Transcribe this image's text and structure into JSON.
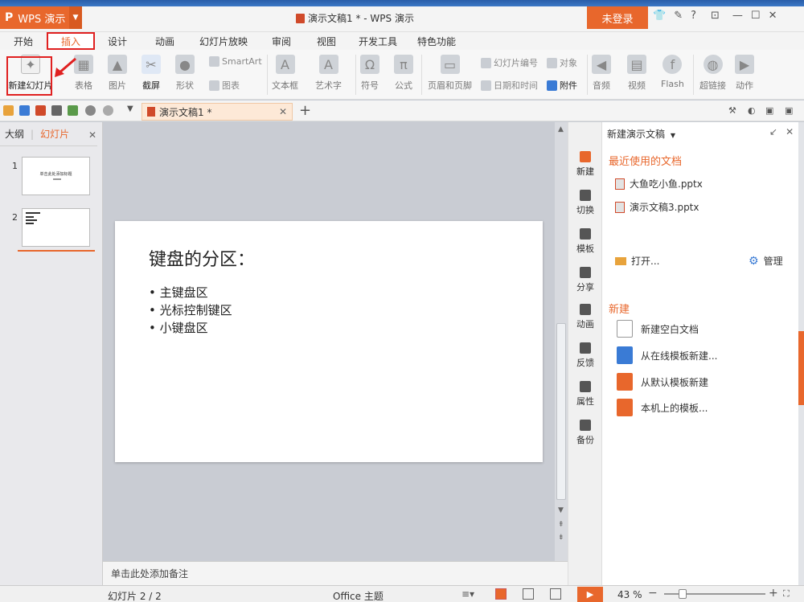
{
  "app": {
    "name": "WPS 演示",
    "window_title": "演示文稿1 * - WPS 演示",
    "login_label": "未登录"
  },
  "menu_tabs": [
    "开始",
    "插入",
    "设计",
    "动画",
    "幻灯片放映",
    "审阅",
    "视图",
    "开发工具",
    "特色功能"
  ],
  "active_tab": "插入",
  "ribbon": {
    "new_slide": "新建幻灯片",
    "table": "表格",
    "picture": "图片",
    "screenshot": "截屏",
    "shape": "形状",
    "smartart": "SmartArt",
    "chart": "图表",
    "textbox": "文本框",
    "wordart": "艺术字",
    "symbol": "符号",
    "formula": "公式",
    "header_footer": "页眉和页脚",
    "slide_number": "幻灯片编号",
    "object": "对象",
    "date_time": "日期和时间",
    "attachment": "附件",
    "audio": "音频",
    "video": "视频",
    "flash": "Flash",
    "hyperlink": "超链接",
    "action": "动作"
  },
  "doc_tab": {
    "label": "演示文稿1 *"
  },
  "left_pane": {
    "tab_outline": "大纲",
    "tab_slides": "幻灯片",
    "slide_numbers": [
      "1",
      "2"
    ],
    "thumb1_title": "单击此处添加标题"
  },
  "slide": {
    "title": "键盘的分区：",
    "bullets": [
      "• 主键盘区",
      "• 光标控制键区",
      "• 小键盘区"
    ]
  },
  "notes_placeholder": "单击此处添加备注",
  "sidebar": [
    "新建",
    "切换",
    "模板",
    "分享",
    "动画",
    "反馈",
    "属性",
    "备份"
  ],
  "task_pane": {
    "header": "新建演示文稿",
    "recent_title": "最近使用的文档",
    "recent_files": [
      "大鱼吃小鱼.pptx",
      "演示文稿3.pptx"
    ],
    "open_label": "打开...",
    "manage_label": "管理",
    "new_title": "新建",
    "new_items": [
      "新建空白文档",
      "从在线模板新建...",
      "从默认模板新建",
      "本机上的模板..."
    ]
  },
  "status": {
    "slide_info": "幻灯片 2 / 2",
    "theme": "Office 主题",
    "zoom": "43 %",
    "zoom_percent": 43
  },
  "colors": {
    "accent": "#e8672c",
    "highlight": "#e02020"
  }
}
